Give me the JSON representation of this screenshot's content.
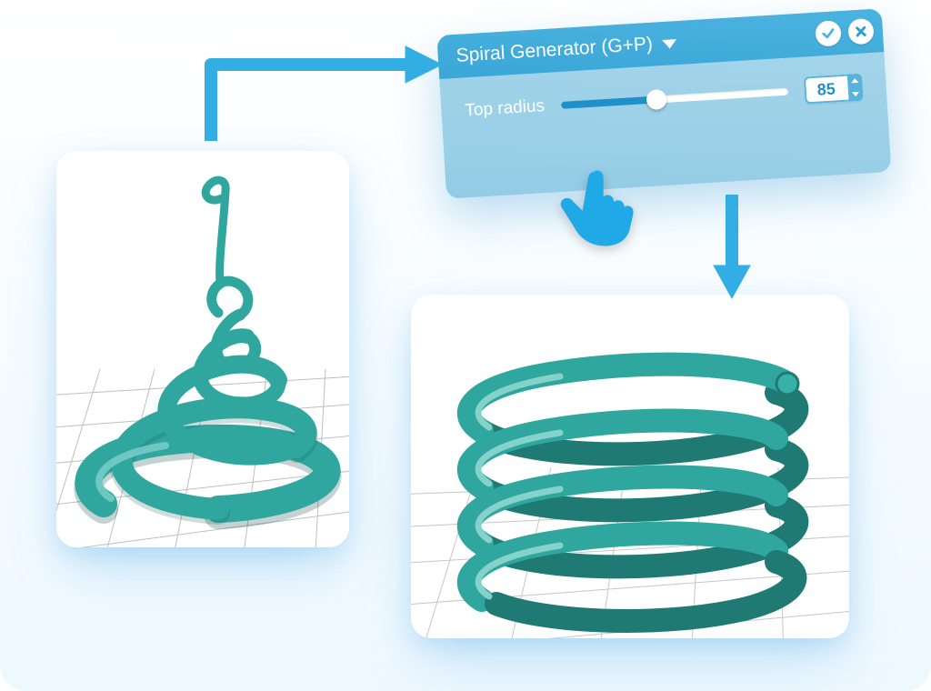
{
  "panel": {
    "title": "Spiral Generator (G+P)",
    "param_label": "Top radius",
    "value": "85",
    "slider_percent": 42
  },
  "icons": {
    "dropdown": "chevron-down-icon",
    "confirm": "check-icon",
    "close": "close-icon",
    "pointer": "pointer-hand-icon"
  },
  "colors": {
    "accent": "#32aee4",
    "spiral": "#2fa79f"
  }
}
